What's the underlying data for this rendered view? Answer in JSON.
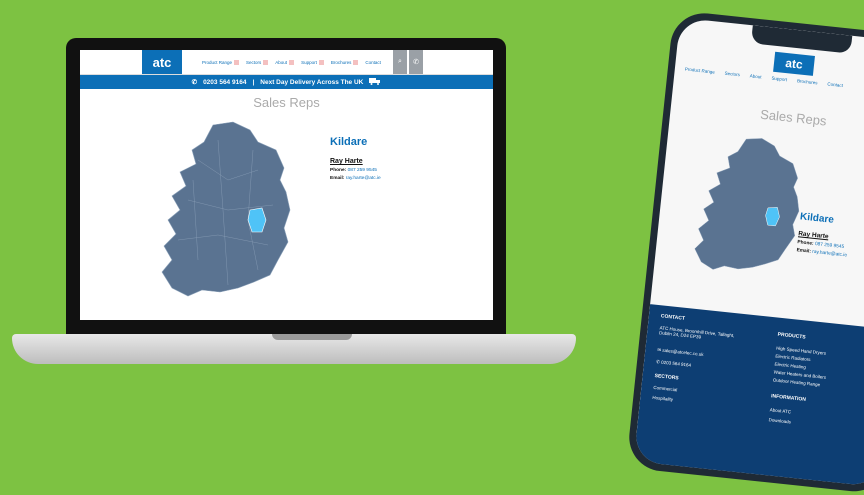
{
  "site": {
    "logo_text": "atc",
    "nav": [
      "Product Range",
      "Sectors",
      "About",
      "Support",
      "Brochures",
      "Contact"
    ],
    "search_glyph": "⌕",
    "phone_glyph": "✆",
    "banner_phone": "0203 564 9164",
    "banner_sep": "|",
    "banner_text": "Next Day Delivery Across The UK",
    "page_title": "Sales Reps",
    "county": "Kildare",
    "rep_name": "Ray Harte",
    "phone_label": "Phone:",
    "phone_value": "087 259 9545",
    "email_label": "Email:",
    "email_value": "ray.harte@atc.ie"
  },
  "mobile": {
    "logo_text": "atc",
    "nav": [
      "Product Range",
      "Sectors",
      "About",
      "Support",
      "Brochures",
      "Contact"
    ],
    "page_title": "Sales Reps",
    "county": "Kildare",
    "rep_name": "Ray Harte",
    "phone_label": "Phone:",
    "phone_value": "087 259 9545",
    "email_label": "Email:",
    "email_value": "ray.harte@atc.ie",
    "footer": {
      "contact_heading": "CONTACT",
      "address": "ATC House, Broomhill Drive, Tallaght, Dublin 24, D24 EP39",
      "email": "sales@atcelec.co.uk",
      "phone": "0203 564 9164",
      "sectors_heading": "SECTORS",
      "sectors": [
        "Commercial",
        "Hospitality"
      ],
      "products_heading": "PRODUCTS",
      "products": [
        "High Speed Hand Dryers",
        "Electric Radiators",
        "Electric Heating",
        "Water Heaters and Boilers",
        "Outdoor Heating Range"
      ],
      "info_heading": "INFORMATION",
      "info": [
        "About ATC",
        "Downloads"
      ]
    }
  },
  "colors": {
    "background": "#7dc242",
    "brand_blue": "#0c6fb7",
    "map_fill": "#5a7391",
    "highlight": "#4fc3f7",
    "footer": "#0d3e73"
  }
}
